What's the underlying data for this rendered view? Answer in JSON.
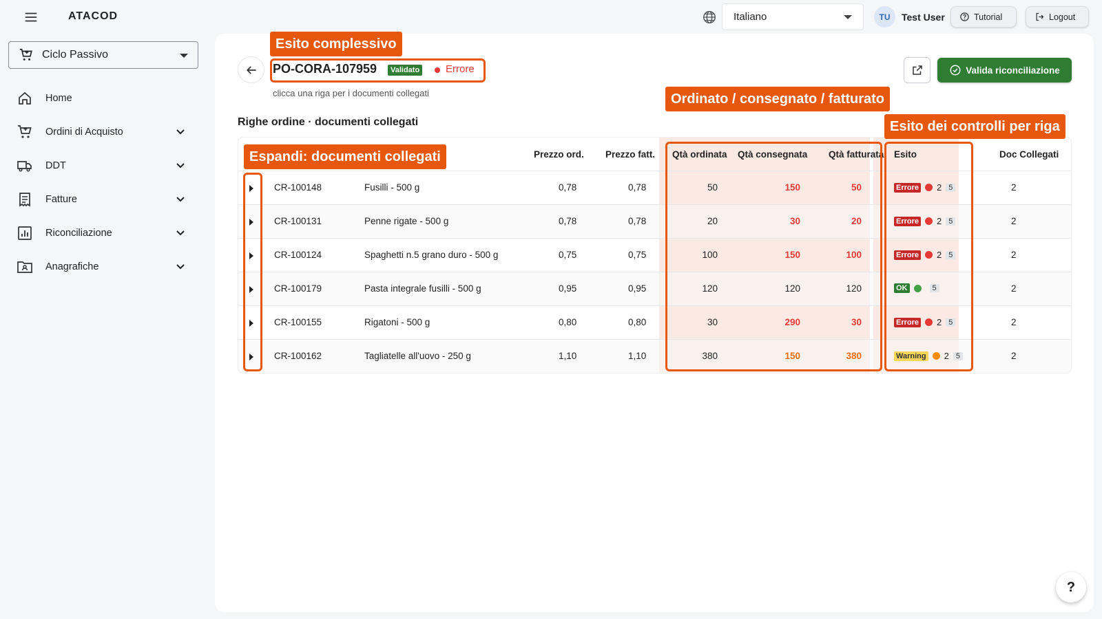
{
  "topbar": {
    "brand": "ATACOD",
    "language": "Italiano",
    "user_initials": "TU",
    "user_name": "Test User",
    "tutorial_label": "Tutorial",
    "logout_label": "Logout"
  },
  "sidebar": {
    "cycle": "Ciclo Passivo",
    "items": [
      {
        "label": "Home",
        "icon": "home-icon"
      },
      {
        "label": "Ordini di Acquisto",
        "icon": "cart-icon"
      },
      {
        "label": "DDT",
        "icon": "truck-icon"
      },
      {
        "label": "Fatture",
        "icon": "invoice-icon"
      },
      {
        "label": "Riconciliazione",
        "icon": "chart-icon"
      },
      {
        "label": "Anagrafiche",
        "icon": "folder-user-icon"
      }
    ]
  },
  "header": {
    "po_code": "PO-CORA-107959",
    "validated_badge": "Validato",
    "overall_status": "Errore",
    "subtitle": "clicca una riga per i documenti collegati",
    "validate_button": "Valida riconciliazione",
    "section_title": "Righe ordine · documenti collegati"
  },
  "table": {
    "headers": {
      "price_ord": "Prezzo ord.",
      "price_fatt": "Prezzo fatt.",
      "qty_ord": "Qtà ordinata",
      "qty_cons": "Qtà consegnata",
      "qty_fatt": "Qtà fatturata",
      "esito": "Esito",
      "docs": "Doc Collegati"
    },
    "rows": [
      {
        "code": "CR-100148",
        "desc": "Fusilli - 500 g",
        "price_ord": "0,78",
        "price_fatt": "0,78",
        "qty_ord": "50",
        "qty_cons": "150",
        "qty_fatt": "50",
        "tag": "Errore",
        "errors": "2",
        "checks": "5",
        "docs": "2"
      },
      {
        "code": "CR-100131",
        "desc": "Penne rigate - 500 g",
        "price_ord": "0,78",
        "price_fatt": "0,78",
        "qty_ord": "20",
        "qty_cons": "30",
        "qty_fatt": "20",
        "tag": "Errore",
        "errors": "2",
        "checks": "5",
        "docs": "2"
      },
      {
        "code": "CR-100124",
        "desc": "Spaghetti n.5 grano duro - 500 g",
        "price_ord": "0,75",
        "price_fatt": "0,75",
        "qty_ord": "100",
        "qty_cons": "150",
        "qty_fatt": "100",
        "tag": "Errore",
        "errors": "2",
        "checks": "5",
        "docs": "2"
      },
      {
        "code": "CR-100179",
        "desc": "Pasta integrale fusilli - 500 g",
        "price_ord": "0,95",
        "price_fatt": "0,95",
        "qty_ord": "120",
        "qty_cons": "120",
        "qty_fatt": "120",
        "tag": "OK",
        "errors": "",
        "checks": "5",
        "docs": "2"
      },
      {
        "code": "CR-100155",
        "desc": "Rigatoni - 500 g",
        "price_ord": "0,80",
        "price_fatt": "0,80",
        "qty_ord": "30",
        "qty_cons": "290",
        "qty_fatt": "30",
        "tag": "Errore",
        "errors": "2",
        "checks": "5",
        "docs": "2"
      },
      {
        "code": "CR-100162",
        "desc": "Tagliatelle all'uovo - 250 g",
        "price_ord": "1,10",
        "price_fatt": "1,10",
        "qty_ord": "380",
        "qty_cons": "150",
        "qty_fatt": "380",
        "tag": "Warning",
        "errors": "2",
        "checks": "5",
        "docs": "2"
      }
    ]
  },
  "annotations": {
    "overall": "Esito complessivo",
    "quantities": "Ordinato / consegnato / fatturato",
    "row_checks": "Esito dei controlli per riga",
    "expand": "Espandi: documenti collegati"
  },
  "help_label": "?",
  "colors": {
    "accent_orange": "#e8570e",
    "success_green": "#2e7d32",
    "error_red": "#e53935",
    "warning_orange": "#ef6c00"
  }
}
